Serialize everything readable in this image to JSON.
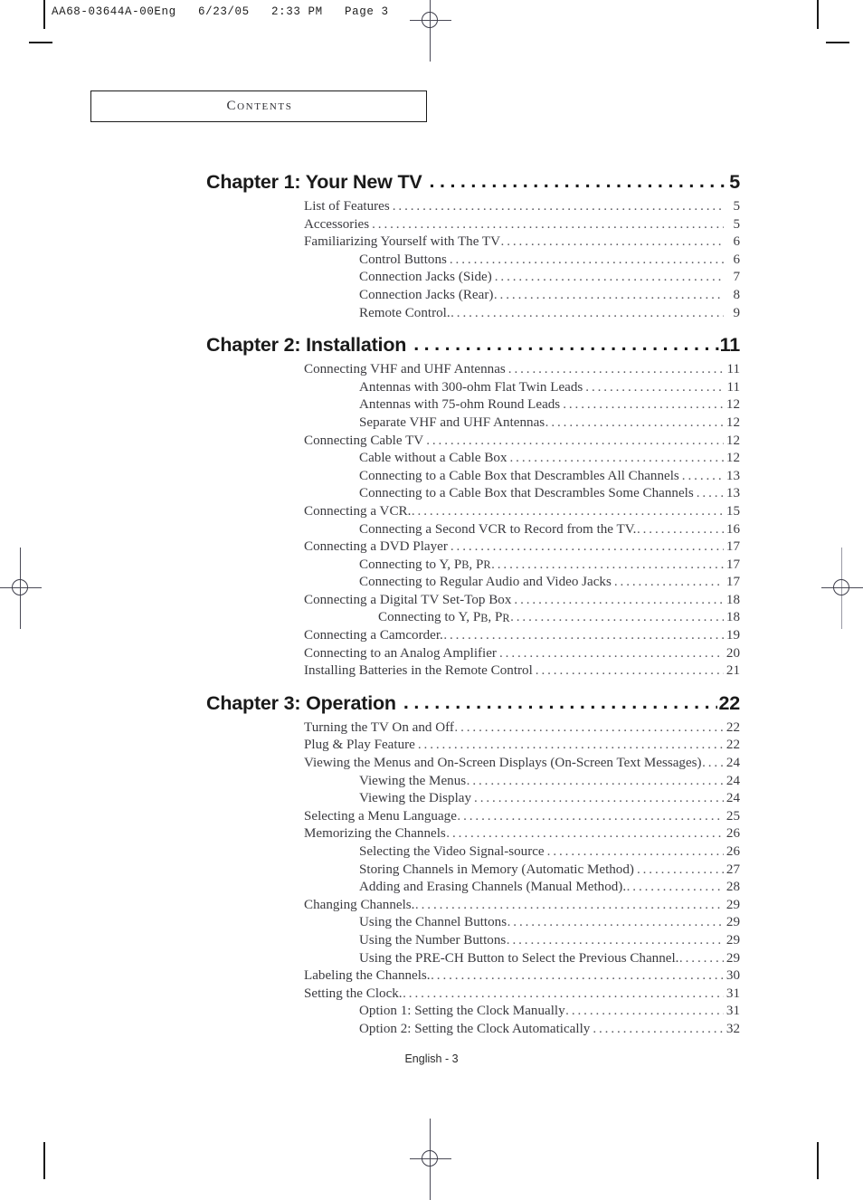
{
  "page": {
    "print_header": "AA68-03644A-00Eng   6/23/05   2:33 PM   Page 3",
    "contents_title": "Contents",
    "footer": "English - 3",
    "leader_dots_chapter": "...............................................",
    "leader_dots_entry": "........................................................................................"
  },
  "toc": {
    "chapters": [
      {
        "title": "Chapter 1: Your New TV",
        "page": "5",
        "entries": [
          {
            "level": 1,
            "label": "List of Features",
            "page": "5"
          },
          {
            "level": 1,
            "label": "Accessories",
            "page": "5"
          },
          {
            "level": 1,
            "label": "Familiarizing Yourself with The TV",
            "page": "6",
            "tight": true
          },
          {
            "level": 2,
            "label": "Control Buttons",
            "page": "6"
          },
          {
            "level": 2,
            "label": "Connection Jacks (Side)",
            "page": "7"
          },
          {
            "level": 2,
            "label": "Connection Jacks (Rear)",
            "page": "8",
            "tight": true
          },
          {
            "level": 2,
            "label": "Remote Control.",
            "page": "9",
            "tight": true
          }
        ]
      },
      {
        "title": "Chapter 2: Installation",
        "page": "11",
        "entries": [
          {
            "level": 1,
            "label": "Connecting VHF and UHF Antennas",
            "page": "11"
          },
          {
            "level": 2,
            "label": "Antennas with 300-ohm Flat Twin Leads",
            "page": "11"
          },
          {
            "level": 2,
            "label": "Antennas with 75-ohm Round Leads",
            "page": "12"
          },
          {
            "level": 2,
            "label": "Separate VHF and UHF Antennas",
            "page": "12",
            "tight": true
          },
          {
            "level": 1,
            "label": "Connecting Cable TV",
            "page": "12"
          },
          {
            "level": 2,
            "label": "Cable without a Cable Box",
            "page": "12"
          },
          {
            "level": 2,
            "label": "Connecting to a Cable Box that Descrambles All Channels",
            "page": "13"
          },
          {
            "level": 2,
            "label": "Connecting to a Cable Box that Descrambles Some Channels",
            "page": "13"
          },
          {
            "level": 1,
            "label": "Connecting a VCR.",
            "page": "15",
            "tight": true
          },
          {
            "level": 2,
            "label": "Connecting a Second VCR to Record from the TV.",
            "page": "16",
            "tight": true
          },
          {
            "level": 1,
            "label": "Connecting a DVD Player",
            "page": "17"
          },
          {
            "level": 2,
            "label": "Connecting to Y, Pʙ, Pʀ",
            "page": "17",
            "tight": true,
            "subscript": true
          },
          {
            "level": 2,
            "label": "Connecting to Regular Audio and Video Jacks",
            "page": "17"
          },
          {
            "level": 1,
            "label": "Connecting a Digital TV Set-Top Box",
            "page": "18"
          },
          {
            "level": 2,
            "label": "Connecting to Y, Pʙ, Pʀ",
            "page": "18",
            "tight": true,
            "subscript": true,
            "extra_indent": true
          },
          {
            "level": 1,
            "label": "Connecting a Camcorder.",
            "page": "19",
            "tight": true
          },
          {
            "level": 1,
            "label": "Connecting to an Analog Amplifier",
            "page": "20"
          },
          {
            "level": 1,
            "label": "Installing Batteries in the Remote Control",
            "page": "21"
          }
        ]
      },
      {
        "title": "Chapter 3: Operation",
        "page": "22",
        "entries": [
          {
            "level": 1,
            "label": "Turning the TV On and Off",
            "page": "22",
            "tight": true
          },
          {
            "level": 1,
            "label": "Plug & Play Feature",
            "page": "22"
          },
          {
            "level": 1,
            "label": "Viewing the Menus and On-Screen Displays (On-Screen Text Messages)",
            "page": "24",
            "tight": true
          },
          {
            "level": 2,
            "label": "Viewing the Menus",
            "page": "24",
            "tight": true
          },
          {
            "level": 2,
            "label": "Viewing the Display",
            "page": "24"
          },
          {
            "level": 1,
            "label": "Selecting a Menu Language",
            "page": "25",
            "tight": true
          },
          {
            "level": 1,
            "label": "Memorizing the Channels",
            "page": "26",
            "tight": true
          },
          {
            "level": 2,
            "label": "Selecting the Video Signal-source",
            "page": "26"
          },
          {
            "level": 2,
            "label": "Storing Channels in Memory (Automatic Method)",
            "page": "27"
          },
          {
            "level": 2,
            "label": "Adding and Erasing Channels (Manual Method).",
            "page": "28",
            "tight": true
          },
          {
            "level": 1,
            "label": "Changing Channels.",
            "page": "29",
            "tight": true
          },
          {
            "level": 2,
            "label": "Using the Channel Buttons",
            "page": "29",
            "tight": true
          },
          {
            "level": 2,
            "label": "Using the Number Buttons",
            "page": "29",
            "tight": true
          },
          {
            "level": 2,
            "label": "Using the PRE-CH Button to Select the Previous Channel.",
            "page": "29",
            "tight": true
          },
          {
            "level": 1,
            "label": "Labeling the Channels.",
            "page": "30",
            "tight": true
          },
          {
            "level": 1,
            "label": "Setting the Clock.",
            "page": "31",
            "tight": true
          },
          {
            "level": 2,
            "label": "Option 1: Setting the Clock Manually",
            "page": "31",
            "tight": true
          },
          {
            "level": 2,
            "label": "Option 2: Setting the Clock Automatically",
            "page": "32"
          }
        ]
      }
    ]
  }
}
